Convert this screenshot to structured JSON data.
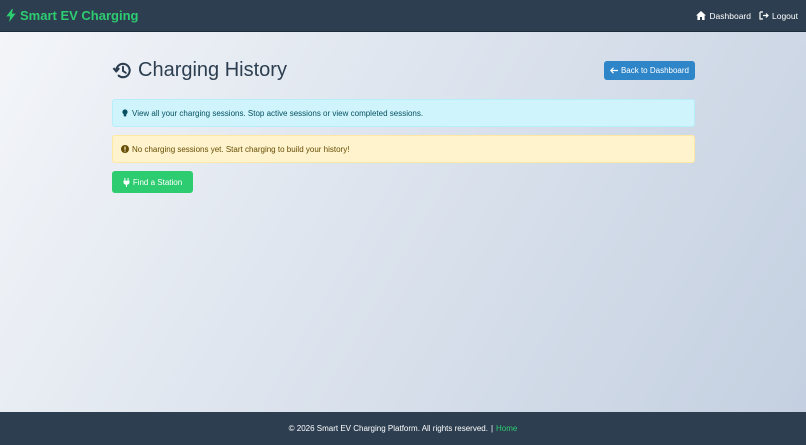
{
  "navbar": {
    "brand": "Smart EV Charging",
    "brand_icon": "bolt-icon",
    "links": [
      {
        "label": "Dashboard",
        "icon": "home-icon"
      },
      {
        "label": "Logout",
        "icon": "logout-icon"
      }
    ]
  },
  "page": {
    "title": "Charging History",
    "title_icon": "history-icon",
    "back_button": "Back to Dashboard"
  },
  "alerts": {
    "info": "View all your charging sessions. Stop active sessions or view completed sessions.",
    "warning": "No charging sessions yet. Start charging to build your history!"
  },
  "actions": {
    "find_station": "Find a Station"
  },
  "footer": {
    "copyright": "© 2026 Smart EV Charging Platform. All rights reserved.",
    "separator": "|",
    "home_link": "Home"
  },
  "colors": {
    "navbar_bg": "#2c3e50",
    "brand_green": "#2ecc71",
    "primary_blue": "#2e86c9",
    "info_bg": "#cff4fc",
    "warning_bg": "#fff3cd"
  }
}
